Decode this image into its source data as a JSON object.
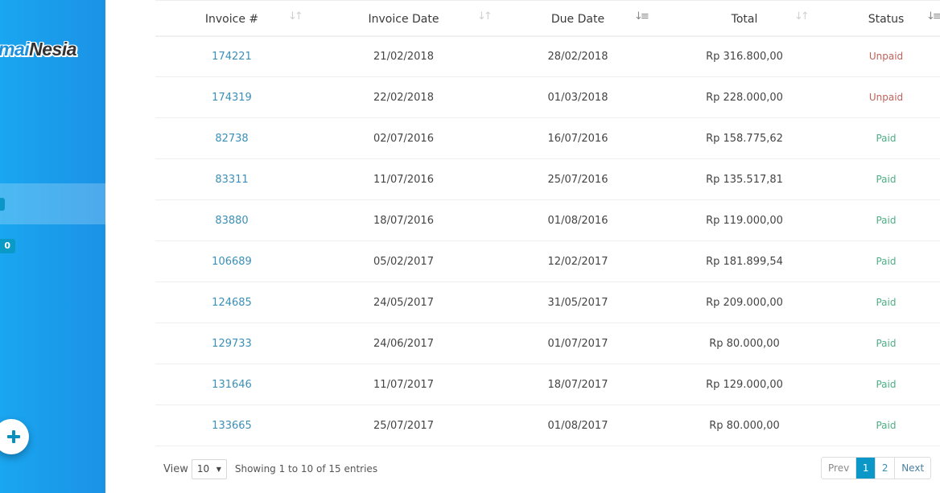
{
  "sidebar": {
    "logo_part1": "mai",
    "logo_part2": "Nesia",
    "badge_count": "0",
    "fab_icon": "plus-icon"
  },
  "table": {
    "columns": [
      {
        "label": "Invoice #",
        "sort_icon": "sort-both-icon"
      },
      {
        "label": "Invoice Date",
        "sort_icon": "sort-both-icon"
      },
      {
        "label": "Due Date",
        "sort_icon": "sort-ascending-icon"
      },
      {
        "label": "Total",
        "sort_icon": "sort-both-icon"
      },
      {
        "label": "Status",
        "sort_icon": "sort-descending-icon"
      }
    ],
    "rows": [
      {
        "invoice": "174221",
        "invoice_date": "21/02/2018",
        "due_date": "28/02/2018",
        "total": "Rp 316.800,00",
        "status": "Unpaid"
      },
      {
        "invoice": "174319",
        "invoice_date": "22/02/2018",
        "due_date": "01/03/2018",
        "total": "Rp 228.000,00",
        "status": "Unpaid"
      },
      {
        "invoice": "82738",
        "invoice_date": "02/07/2016",
        "due_date": "16/07/2016",
        "total": "Rp 158.775,62",
        "status": "Paid"
      },
      {
        "invoice": "83311",
        "invoice_date": "11/07/2016",
        "due_date": "25/07/2016",
        "total": "Rp 135.517,81",
        "status": "Paid"
      },
      {
        "invoice": "83880",
        "invoice_date": "18/07/2016",
        "due_date": "01/08/2016",
        "total": "Rp 119.000,00",
        "status": "Paid"
      },
      {
        "invoice": "106689",
        "invoice_date": "05/02/2017",
        "due_date": "12/02/2017",
        "total": "Rp 181.899,54",
        "status": "Paid"
      },
      {
        "invoice": "124685",
        "invoice_date": "24/05/2017",
        "due_date": "31/05/2017",
        "total": "Rp 209.000,00",
        "status": "Paid"
      },
      {
        "invoice": "129733",
        "invoice_date": "24/06/2017",
        "due_date": "01/07/2017",
        "total": "Rp 80.000,00",
        "status": "Paid"
      },
      {
        "invoice": "131646",
        "invoice_date": "11/07/2017",
        "due_date": "18/07/2017",
        "total": "Rp 129.000,00",
        "status": "Paid"
      },
      {
        "invoice": "133665",
        "invoice_date": "25/07/2017",
        "due_date": "01/08/2017",
        "total": "Rp 80.000,00",
        "status": "Paid"
      }
    ]
  },
  "footer": {
    "view_label": "View",
    "page_size": "10",
    "showing_text": "Showing 1 to 10 of 15 entries"
  },
  "pagination": {
    "prev_label": "Prev",
    "pages": [
      "1",
      "2"
    ],
    "current_page": "1",
    "next_label": "Next"
  },
  "colors": {
    "sidebar": "#1b9ae8",
    "link": "#3b8fb8",
    "unpaid": "#c0625b",
    "paid": "#4fae85",
    "active_page": "#0b98c9"
  }
}
